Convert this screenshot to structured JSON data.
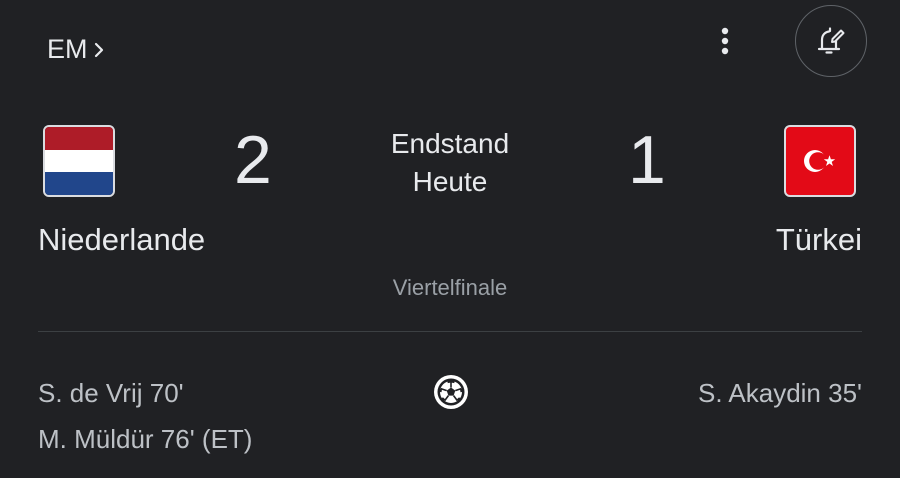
{
  "header": {
    "competition_label": "EM",
    "more_icon": "more-vert-icon",
    "bell_icon": "bell-edit-icon"
  },
  "match": {
    "status_line1": "Endstand",
    "status_line2": "Heute",
    "round": "Viertelfinale",
    "home": {
      "name": "Niederlande",
      "score": "2",
      "flag": "netherlands-flag",
      "scorers": [
        "S. de Vrij 70'",
        "M. Müldür 76' (ET)"
      ]
    },
    "away": {
      "name": "Türkei",
      "score": "1",
      "flag": "turkey-flag",
      "scorers": [
        "S. Akaydin 35'"
      ]
    },
    "goal_icon": "soccer-ball-icon"
  },
  "colors": {
    "background": "#202124",
    "text_primary": "#e8eaed",
    "text_secondary": "#9aa0a6",
    "nl_red": "#ae1c28",
    "nl_blue": "#21468b",
    "tr_red": "#e30a17"
  }
}
